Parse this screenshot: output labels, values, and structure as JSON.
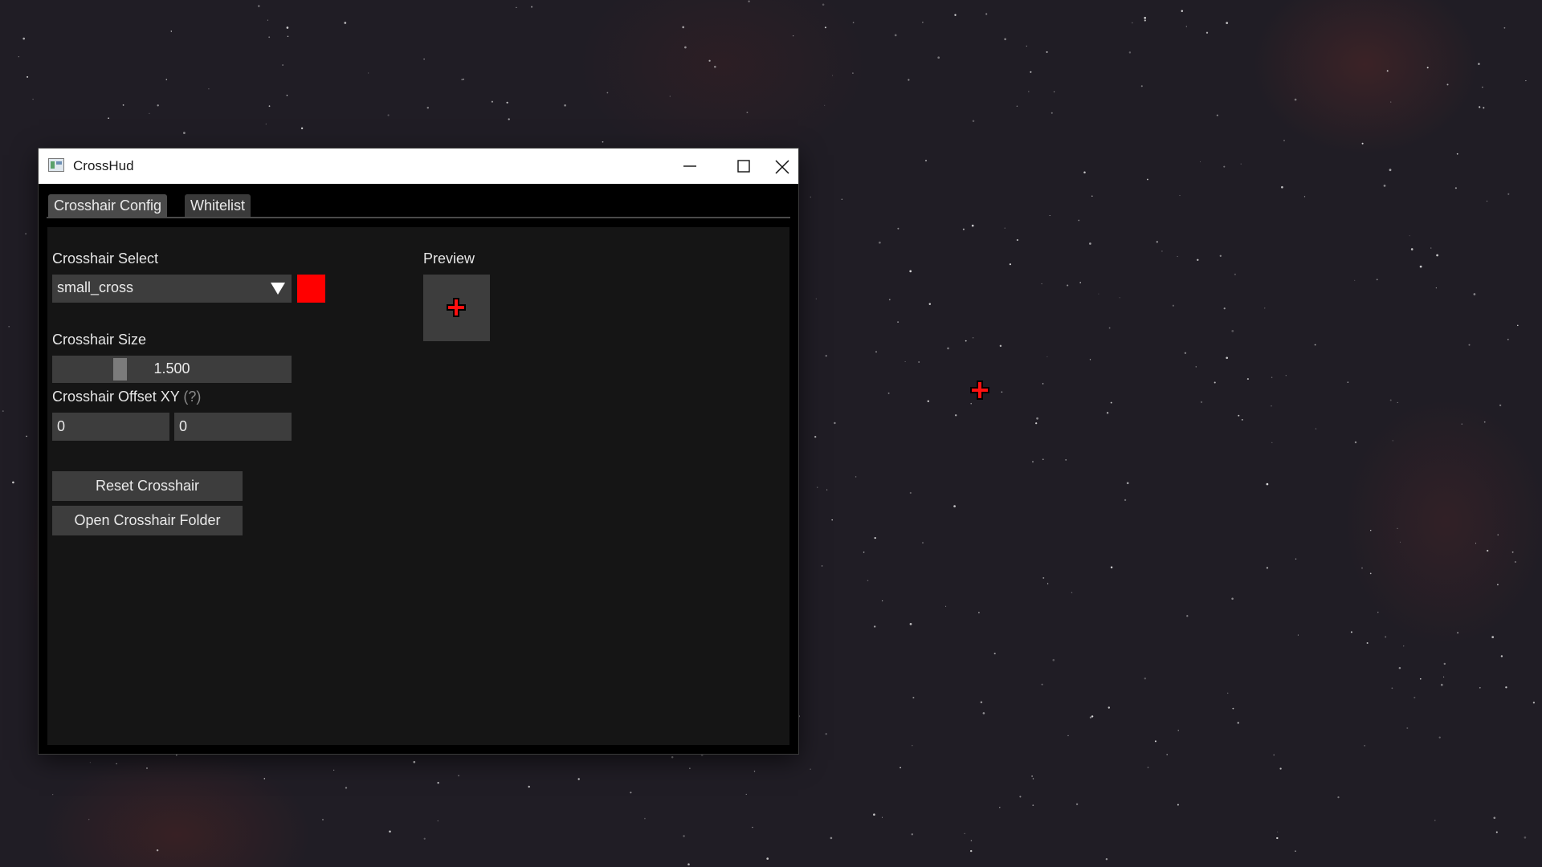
{
  "window": {
    "title": "CrossHud"
  },
  "tabs": [
    {
      "label": "Crosshair Config",
      "active": true
    },
    {
      "label": "Whitelist",
      "active": false
    }
  ],
  "crosshair_select": {
    "label": "Crosshair Select",
    "value": "small_cross",
    "color": "#ff0000"
  },
  "crosshair_size": {
    "label": "Crosshair Size",
    "value": "1.500"
  },
  "crosshair_offset": {
    "label": "Crosshair Offset XY",
    "hint": "(?)",
    "x": "0",
    "y": "0"
  },
  "buttons": {
    "reset": "Reset Crosshair",
    "open_folder": "Open Crosshair Folder"
  },
  "preview": {
    "label": "Preview",
    "crosshair_color": "#ff0000"
  }
}
